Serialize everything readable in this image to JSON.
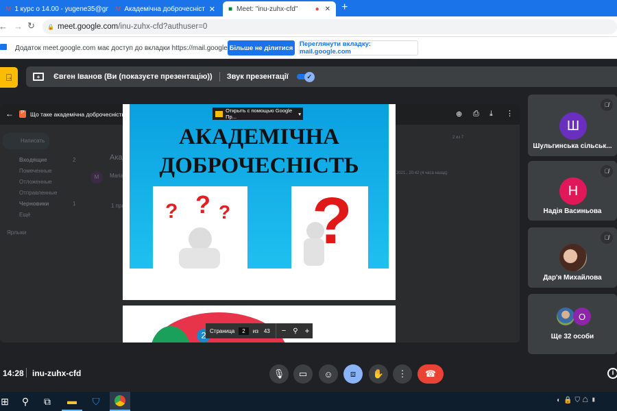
{
  "browser": {
    "tabs": [
      {
        "label": "1 курс о 14.00 - yugene35@gm",
        "active": false
      },
      {
        "label": "Академічна доброчесніст",
        "active": false
      },
      {
        "label": "Meet: \"inu-zuhx-cfd\"",
        "active": true
      }
    ],
    "url_host": "meet.google.com",
    "url_path": "/inu-zuhx-cfd?authuser=0",
    "share_info": "Додаток meet.google.com має доступ до вкладки https://mail.google.com",
    "stop_sharing": "Більше не ділитися",
    "view_tab": "Переглянути вкладку: mail.google.com"
  },
  "meet": {
    "presenter": "Євген Іванов (Ви (показуєте презентацію))",
    "presentation_audio": "Звук презентації",
    "presentation_audio_on": true,
    "time": "14:28",
    "meeting_code": "inu-zuhx-cfd"
  },
  "viewer": {
    "file_name": "Що таке академічна доброчесність.pptx",
    "open_with": "Открыть с помощью Google Пр...",
    "slide_title_1": "АКАДЕМІЧНА",
    "slide_title_2": "ДОБРОЧЕСНІСТЬ",
    "page_label": "Страница",
    "page": "2",
    "of": "из",
    "total": "43",
    "slide2_badge": "2"
  },
  "gmail": {
    "compose": "Написать",
    "items": [
      {
        "label": "Входящие",
        "count": "2"
      },
      {
        "label": "Помеченные"
      },
      {
        "label": "Отложенные"
      },
      {
        "label": "Отправленные"
      },
      {
        "label": "Черновики",
        "count": "1"
      },
      {
        "label": "Ещё"
      }
    ],
    "labels": "Ярлыки",
    "subject": "Акад",
    "sender": "Maria",
    "sender_initial": "M",
    "attach": "1 при",
    "pager": "2 из 7",
    "date": "2021., 20:42 (4 часа назад)"
  },
  "participants": [
    {
      "name": "Шульгинська сільськ...",
      "initial": "Ш",
      "color": "#6a2fbf",
      "muted": true
    },
    {
      "name": "Надія Васиньова",
      "initial": "Н",
      "color": "#e0185a",
      "muted": true
    },
    {
      "name": "Дар'я Михайлова",
      "initial": "",
      "color": "#7a5a4a",
      "muted": true
    },
    {
      "name": "Ще 32 особи",
      "initial": "O",
      "color": "#8e24aa"
    }
  ]
}
